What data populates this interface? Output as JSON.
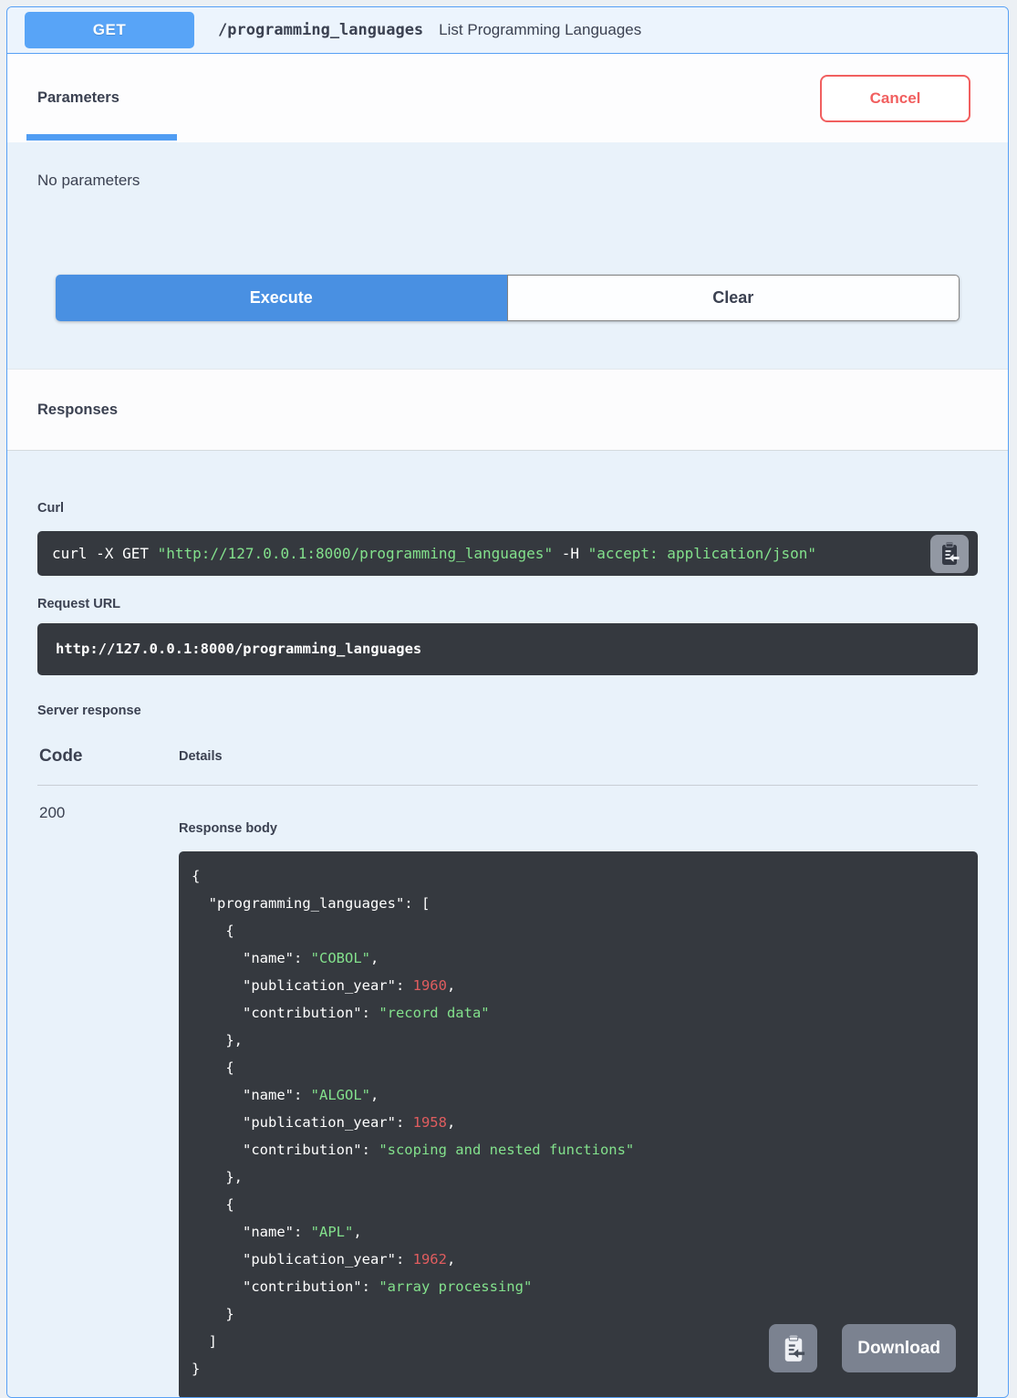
{
  "operation": {
    "method": "GET",
    "path": "/programming_languages",
    "summary": "List Programming Languages"
  },
  "parameters": {
    "tab_label": "Parameters",
    "cancel_label": "Cancel",
    "empty_text": "No parameters",
    "execute_label": "Execute",
    "clear_label": "Clear"
  },
  "responses": {
    "section_title": "Responses",
    "curl": {
      "label": "Curl",
      "cmd_prefix": "curl -X GET ",
      "url_quoted": "\"http://127.0.0.1:8000/programming_languages\"",
      "header_flag": " -H  ",
      "header_quoted": "\"accept: application/json\""
    },
    "request_url": {
      "label": "Request URL",
      "value": "http://127.0.0.1:8000/programming_languages"
    },
    "server_response": {
      "label": "Server response",
      "code_header": "Code",
      "details_header": "Details",
      "status_code": "200",
      "body_label": "Response body",
      "download_label": "Download"
    },
    "body_json": {
      "root_key": "programming_languages",
      "languages": [
        {
          "name": "COBOL",
          "publication_year": 1960,
          "contribution": "record data"
        },
        {
          "name": "ALGOL",
          "publication_year": 1958,
          "contribution": "scoping and nested functions"
        },
        {
          "name": "APL",
          "publication_year": 1962,
          "contribution": "array processing"
        }
      ]
    }
  },
  "colors": {
    "method_blue": "#58a4f7",
    "execute_blue": "#4990e2",
    "cancel_red": "#f15f5f",
    "code_background": "#35393f",
    "string_green": "#83e18c",
    "number_red": "#e05d5f",
    "section_tint": "#e9f2fa"
  }
}
